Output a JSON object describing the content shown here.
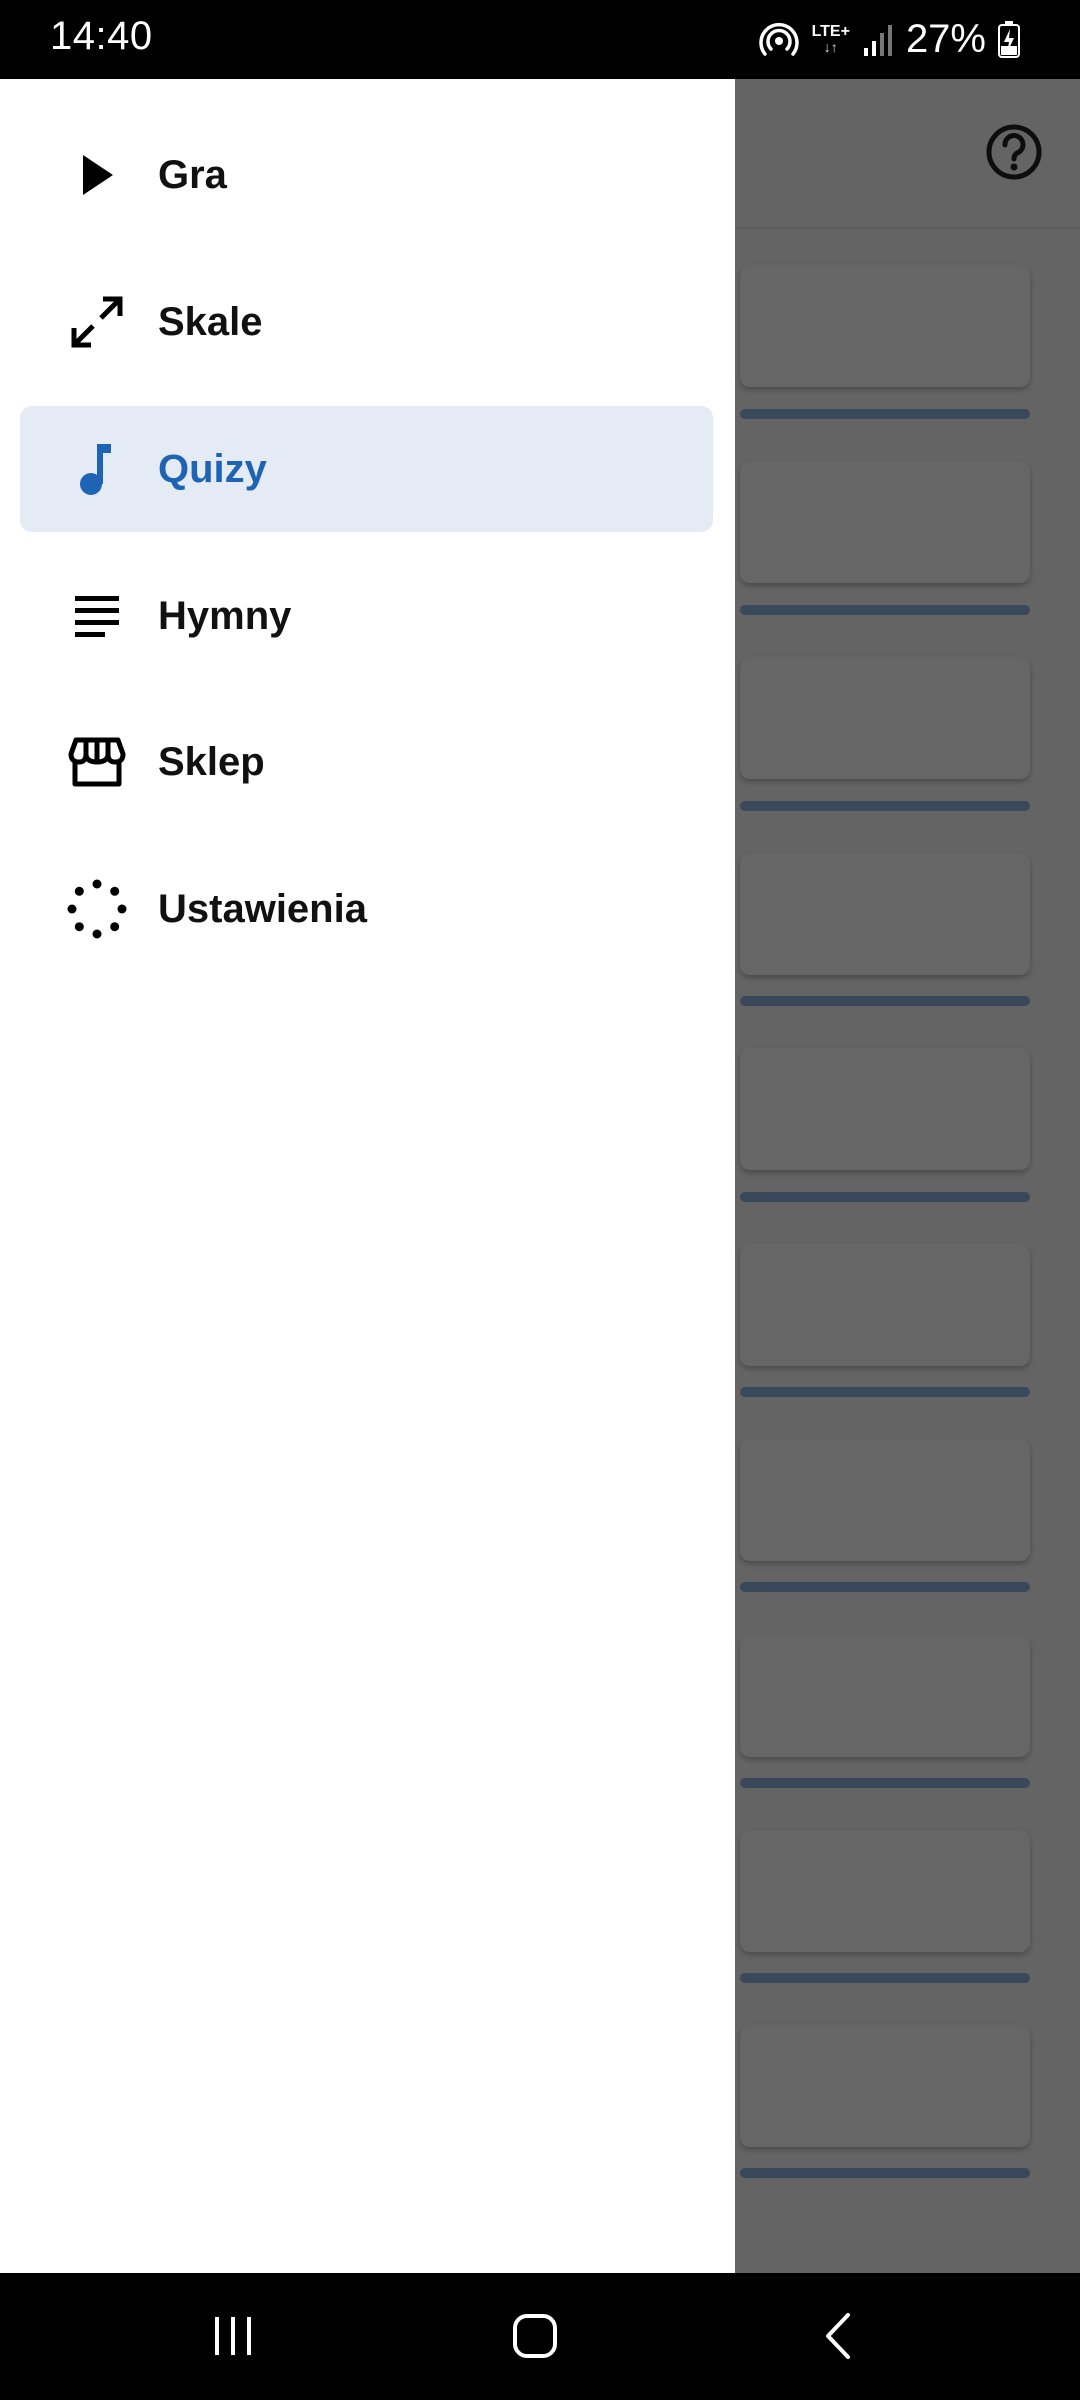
{
  "status_bar": {
    "time": "14:40",
    "network": "LTE+",
    "network_arrows": "↓↑",
    "battery": "27%"
  },
  "drawer": {
    "items": [
      {
        "label": "Gra",
        "icon": "play-icon",
        "active": false
      },
      {
        "label": "Skale",
        "icon": "expand-arrows-icon",
        "active": false
      },
      {
        "label": "Quizy",
        "icon": "music-note-icon",
        "active": true
      },
      {
        "label": "Hymny",
        "icon": "lines-icon",
        "active": false
      },
      {
        "label": "Sklep",
        "icon": "store-icon",
        "active": false
      },
      {
        "label": "Ustawienia",
        "icon": "dotted-circle-icon",
        "active": false
      }
    ]
  },
  "colors": {
    "active_background": "#e4ebf5",
    "active_text": "#1f63b5",
    "scrim": "rgba(0,0,0,0.6)"
  },
  "system_nav": {
    "recents": "recents-icon",
    "home": "home-icon",
    "back": "back-icon"
  }
}
